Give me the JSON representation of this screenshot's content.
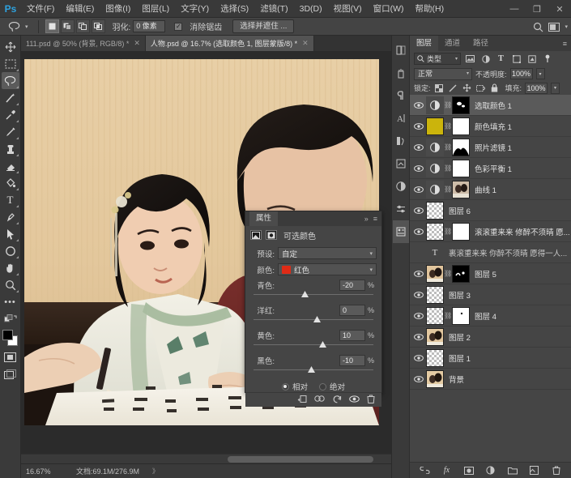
{
  "app": {
    "name": "Adobe Photoshop",
    "logo": "Ps"
  },
  "menubar": {
    "items": [
      {
        "label": "文件(F)"
      },
      {
        "label": "编辑(E)"
      },
      {
        "label": "图像(I)"
      },
      {
        "label": "图层(L)"
      },
      {
        "label": "文字(Y)"
      },
      {
        "label": "选择(S)"
      },
      {
        "label": "滤镜(T)"
      },
      {
        "label": "3D(D)"
      },
      {
        "label": "视图(V)"
      },
      {
        "label": "窗口(W)"
      },
      {
        "label": "帮助(H)"
      }
    ],
    "window_controls": {
      "minimize": "—",
      "maximize": "❐",
      "close": "✕"
    }
  },
  "options_bar": {
    "tool_icon": "lasso-icon",
    "selection_modes": [
      "new-selection",
      "add-to-selection",
      "subtract-from-selection",
      "intersect-selection"
    ],
    "feather_label": "羽化:",
    "feather_value": "0 像素",
    "antialias_label": "消除锯齿",
    "antialias_checked": true,
    "select_and_mask_label": "选择并遮住 ...",
    "right_icons": [
      "search-icon",
      "workspace-icon"
    ]
  },
  "toolbar": {
    "tools": [
      {
        "name": "move-tool",
        "active": false
      },
      {
        "name": "marquee-tool",
        "active": false
      },
      {
        "name": "lasso-tool",
        "active": true
      },
      {
        "name": "magic-wand-tool",
        "active": false
      },
      {
        "name": "eyedropper-tool",
        "active": false
      },
      {
        "name": "brush-tool",
        "active": false
      },
      {
        "name": "clone-stamp-tool",
        "active": false
      },
      {
        "name": "eraser-tool",
        "active": false
      },
      {
        "name": "paint-bucket-tool",
        "active": false
      },
      {
        "name": "type-tool",
        "active": false
      },
      {
        "name": "pen-tool",
        "active": false
      },
      {
        "name": "path-selection-tool",
        "active": false
      },
      {
        "name": "shape-tool",
        "active": false
      },
      {
        "name": "hand-tool",
        "active": false
      },
      {
        "name": "zoom-tool",
        "active": false
      },
      {
        "name": "more-tools",
        "active": false
      }
    ],
    "foreground_color": "#000000",
    "background_color": "#ffffff",
    "screen_mode_icons": [
      "quick-mask-icon",
      "screen-mode-icon"
    ]
  },
  "document_tabs": [
    {
      "label": "111.psd @ 50% (背景, RGB/8) *",
      "active": false,
      "close": "✕"
    },
    {
      "label": "人物.psd @ 16.7% (选取颜色 1, 图层蒙版/8) *",
      "active": true,
      "close": "✕"
    }
  ],
  "status_bar": {
    "zoom": "16.67%",
    "doc_label": "文档:69.1M/276.9M",
    "arrow": "》"
  },
  "properties_panel": {
    "tab_label": "属性",
    "collapse_icon": "»",
    "menu_icon": "≡",
    "adjustment_icons": [
      "selective-color-icon",
      "mask-icon"
    ],
    "title": "可选颜色",
    "preset_label": "预设:",
    "preset_value": "自定",
    "color_label": "颜色:",
    "color_value": "红色",
    "color_swatch": "#e02b16",
    "sliders": [
      {
        "label": "青色:",
        "value": "-20",
        "unit": "%",
        "pos": 40
      },
      {
        "label": "洋红:",
        "value": "0",
        "unit": "%",
        "pos": 50
      },
      {
        "label": "黄色:",
        "value": "10",
        "unit": "%",
        "pos": 55
      },
      {
        "label": "黑色:",
        "value": "-10",
        "unit": "%",
        "pos": 45
      }
    ],
    "mode_relative": "相对",
    "mode_absolute": "绝对",
    "mode_selected": "相对",
    "footer_icons": [
      "clip-to-layer-icon",
      "toggle-previous-icon",
      "reset-icon",
      "visibility-icon",
      "delete-icon"
    ]
  },
  "right_dock": {
    "icons": [
      {
        "name": "libraries-icon",
        "active": false
      },
      {
        "name": "adjustments-icon",
        "active": false
      },
      {
        "name": "paragraph-icon",
        "active": false
      },
      {
        "name": "character-icon",
        "active": false
      },
      {
        "name": "history-icon",
        "active": false
      },
      {
        "name": "actions-icon",
        "active": false
      },
      {
        "name": "adjustment-layer-icon",
        "active": false
      },
      {
        "name": "properties-dock-icon",
        "active": false
      },
      {
        "name": "layer-comps-icon",
        "active": true
      }
    ]
  },
  "layers_panel": {
    "tabs": [
      {
        "label": "图层",
        "active": true
      },
      {
        "label": "通道",
        "active": false
      },
      {
        "label": "路径",
        "active": false
      }
    ],
    "menu_icon": "≡",
    "filter": {
      "icon": "search-icon",
      "label": "类型",
      "chevron": "▾",
      "type_icons": [
        "pixel-filter-icon",
        "adjustment-filter-icon",
        "type-filter-icon",
        "shape-filter-icon",
        "smart-object-filter-icon"
      ],
      "toggle_icon": "filter-power-icon"
    },
    "blend_mode": "正常",
    "opacity_label": "不透明度:",
    "opacity_value": "100%",
    "lock_label": "锁定:",
    "lock_icons": [
      "lock-transparent-icon",
      "lock-image-icon",
      "lock-position-icon",
      "lock-artboard-icon",
      "lock-all-icon"
    ],
    "fill_label": "填充:",
    "fill_value": "100%",
    "layers": [
      {
        "name": "选取颜色 1",
        "visible": true,
        "selected": true,
        "kind": "adjustment",
        "has_mask": true,
        "linked": true
      },
      {
        "name": "颜色填充 1",
        "visible": true,
        "selected": false,
        "kind": "solid-fill",
        "swatch": "#cbb40c",
        "has_mask": true,
        "linked": true
      },
      {
        "name": "照片滤镜 1",
        "visible": true,
        "selected": false,
        "kind": "adjustment",
        "has_mask": true,
        "linked": true
      },
      {
        "name": "色彩平衡 1",
        "visible": true,
        "selected": false,
        "kind": "adjustment",
        "has_mask": true,
        "linked": true
      },
      {
        "name": "曲线 1",
        "visible": true,
        "selected": false,
        "kind": "adjustment",
        "has_mask": true,
        "linked": true
      },
      {
        "name": "图层 6",
        "visible": true,
        "selected": false,
        "kind": "pixel-transparent",
        "has_mask": false,
        "linked": false
      },
      {
        "name": "滚滚重来来 修醉不须晴 愿...",
        "visible": true,
        "selected": false,
        "kind": "pixel-transparent",
        "has_mask": true,
        "linked": true
      },
      {
        "name": "裹滚重来来 你醉不须晴 愿得一人...",
        "visible": false,
        "selected": false,
        "kind": "type",
        "has_mask": false,
        "linked": false
      },
      {
        "name": "图层 5",
        "visible": true,
        "selected": false,
        "kind": "photo",
        "has_mask": true,
        "linked": true
      },
      {
        "name": "图层 3",
        "visible": true,
        "selected": false,
        "kind": "pixel-transparent",
        "has_mask": false,
        "linked": false
      },
      {
        "name": "图层 4",
        "visible": true,
        "selected": false,
        "kind": "pixel-transparent",
        "has_mask": true,
        "linked": true
      },
      {
        "name": "图层 2",
        "visible": true,
        "selected": false,
        "kind": "photo",
        "has_mask": false,
        "linked": false
      },
      {
        "name": "图层 1",
        "visible": true,
        "selected": false,
        "kind": "pixel-transparent",
        "has_mask": false,
        "linked": false
      },
      {
        "name": "背景",
        "visible": true,
        "selected": false,
        "kind": "photo",
        "has_mask": false,
        "linked": false
      }
    ],
    "footer_icons": [
      "link-layers-icon",
      "layer-style-fx-icon",
      "add-mask-icon",
      "adjustment-layer-icon",
      "new-group-icon",
      "new-layer-icon",
      "delete-layer-icon"
    ]
  },
  "canvas": {
    "description": "传统中式服装情侣书法照片",
    "zoom": "16.67%"
  }
}
